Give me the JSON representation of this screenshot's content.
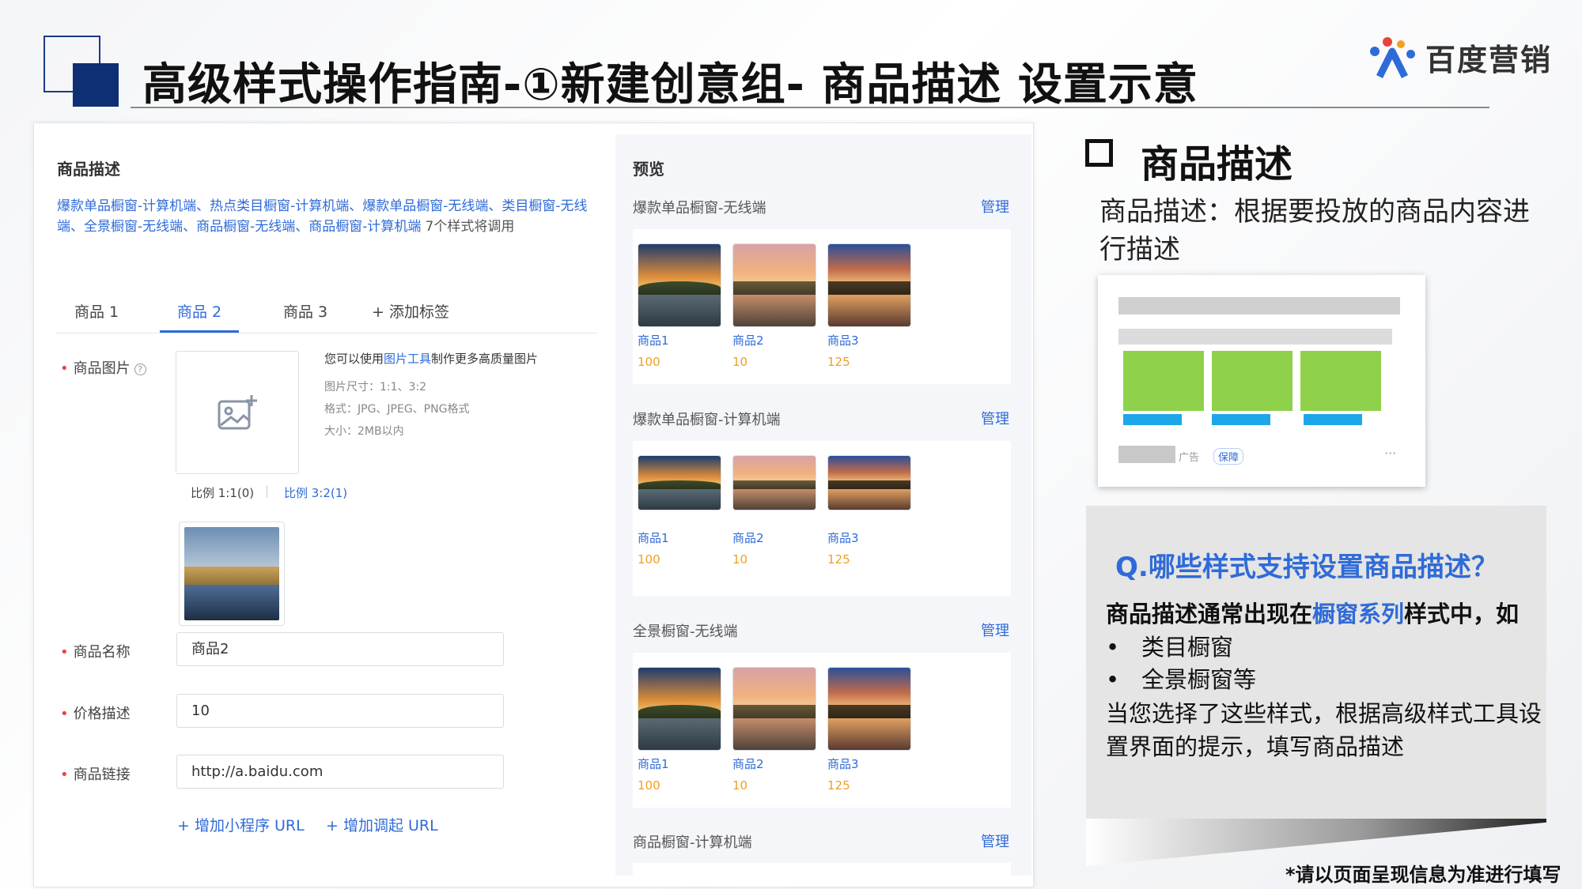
{
  "slide": {
    "title": "高级样式操作指南-①新建创意组- 商品描述  设置示意",
    "logo_text": "百度营销",
    "footnote": "*请以页面呈现信息为准进行填写"
  },
  "editor": {
    "section_title": "商品描述",
    "styles_list": "爆款单品橱窗-计算机端、热点类目橱窗-计算机端、爆款单品橱窗-无线端、类目橱窗-无线端、全景橱窗-无线端、商品橱窗-无线端、商品橱窗-计算机端",
    "styles_count_suffix": "7个样式将调用",
    "tabs": [
      {
        "label": "商品 1"
      },
      {
        "label": "商品 2"
      },
      {
        "label": "商品 3"
      },
      {
        "label": "+ 添加标签"
      }
    ],
    "image_label": "商品图片",
    "image_hint_prefix": "您可以使用",
    "image_hint_link": "图片工具",
    "image_hint_suffix": "制作更多高质量图片",
    "image_size": "图片尺寸：1:1、3:2",
    "image_format": "格式：JPG、JPEG、PNG格式",
    "image_limit": "大小：2MB以内",
    "ratio_1_1": "比例 1:1(0)",
    "ratio_3_2": "比例 3:2(1)",
    "name_label": "商品名称",
    "name_value": "商品2",
    "price_label": "价格描述",
    "price_value": "10",
    "link_label": "商品链接",
    "link_value": "http://a.baidu.com",
    "add_mini_program": "+ 增加小程序 URL",
    "add_callup": "+ 增加调起 URL"
  },
  "preview": {
    "title": "预览",
    "manage_label": "管理",
    "sections": [
      {
        "title": "爆款单品橱窗-无线端"
      },
      {
        "title": "爆款单品橱窗-计算机端"
      },
      {
        "title": "全景橱窗-无线端"
      },
      {
        "title": "商品橱窗-计算机端"
      }
    ],
    "products": [
      {
        "name": "商品1",
        "price": "100"
      },
      {
        "name": "商品2",
        "price": "10"
      },
      {
        "name": "商品3",
        "price": "125"
      }
    ]
  },
  "explain": {
    "heading": "商品描述",
    "description": "商品描述：根据要投放的商品内容进行描述",
    "mock_ad_text": "广告",
    "mock_badge": "保障",
    "mock_more": "···",
    "question": "Q.哪些样式支持设置商品描述？",
    "answer_prefix": "商品描述通常出现在",
    "answer_highlight": "橱窗系列",
    "answer_suffix": "样式中，如",
    "bullets": [
      "类目橱窗",
      "全景橱窗等"
    ],
    "closing_line1": "当您选择了这些样式，根据高级样式工具设",
    "closing_line2": "置界面的提示，填写商品描述"
  },
  "colors": {
    "accent_blue": "#2f6bd8",
    "title_navy": "#0f2f74",
    "price_orange": "#f0a020",
    "mock_green": "#8fd14b",
    "mock_blue": "#1ea7e8"
  }
}
